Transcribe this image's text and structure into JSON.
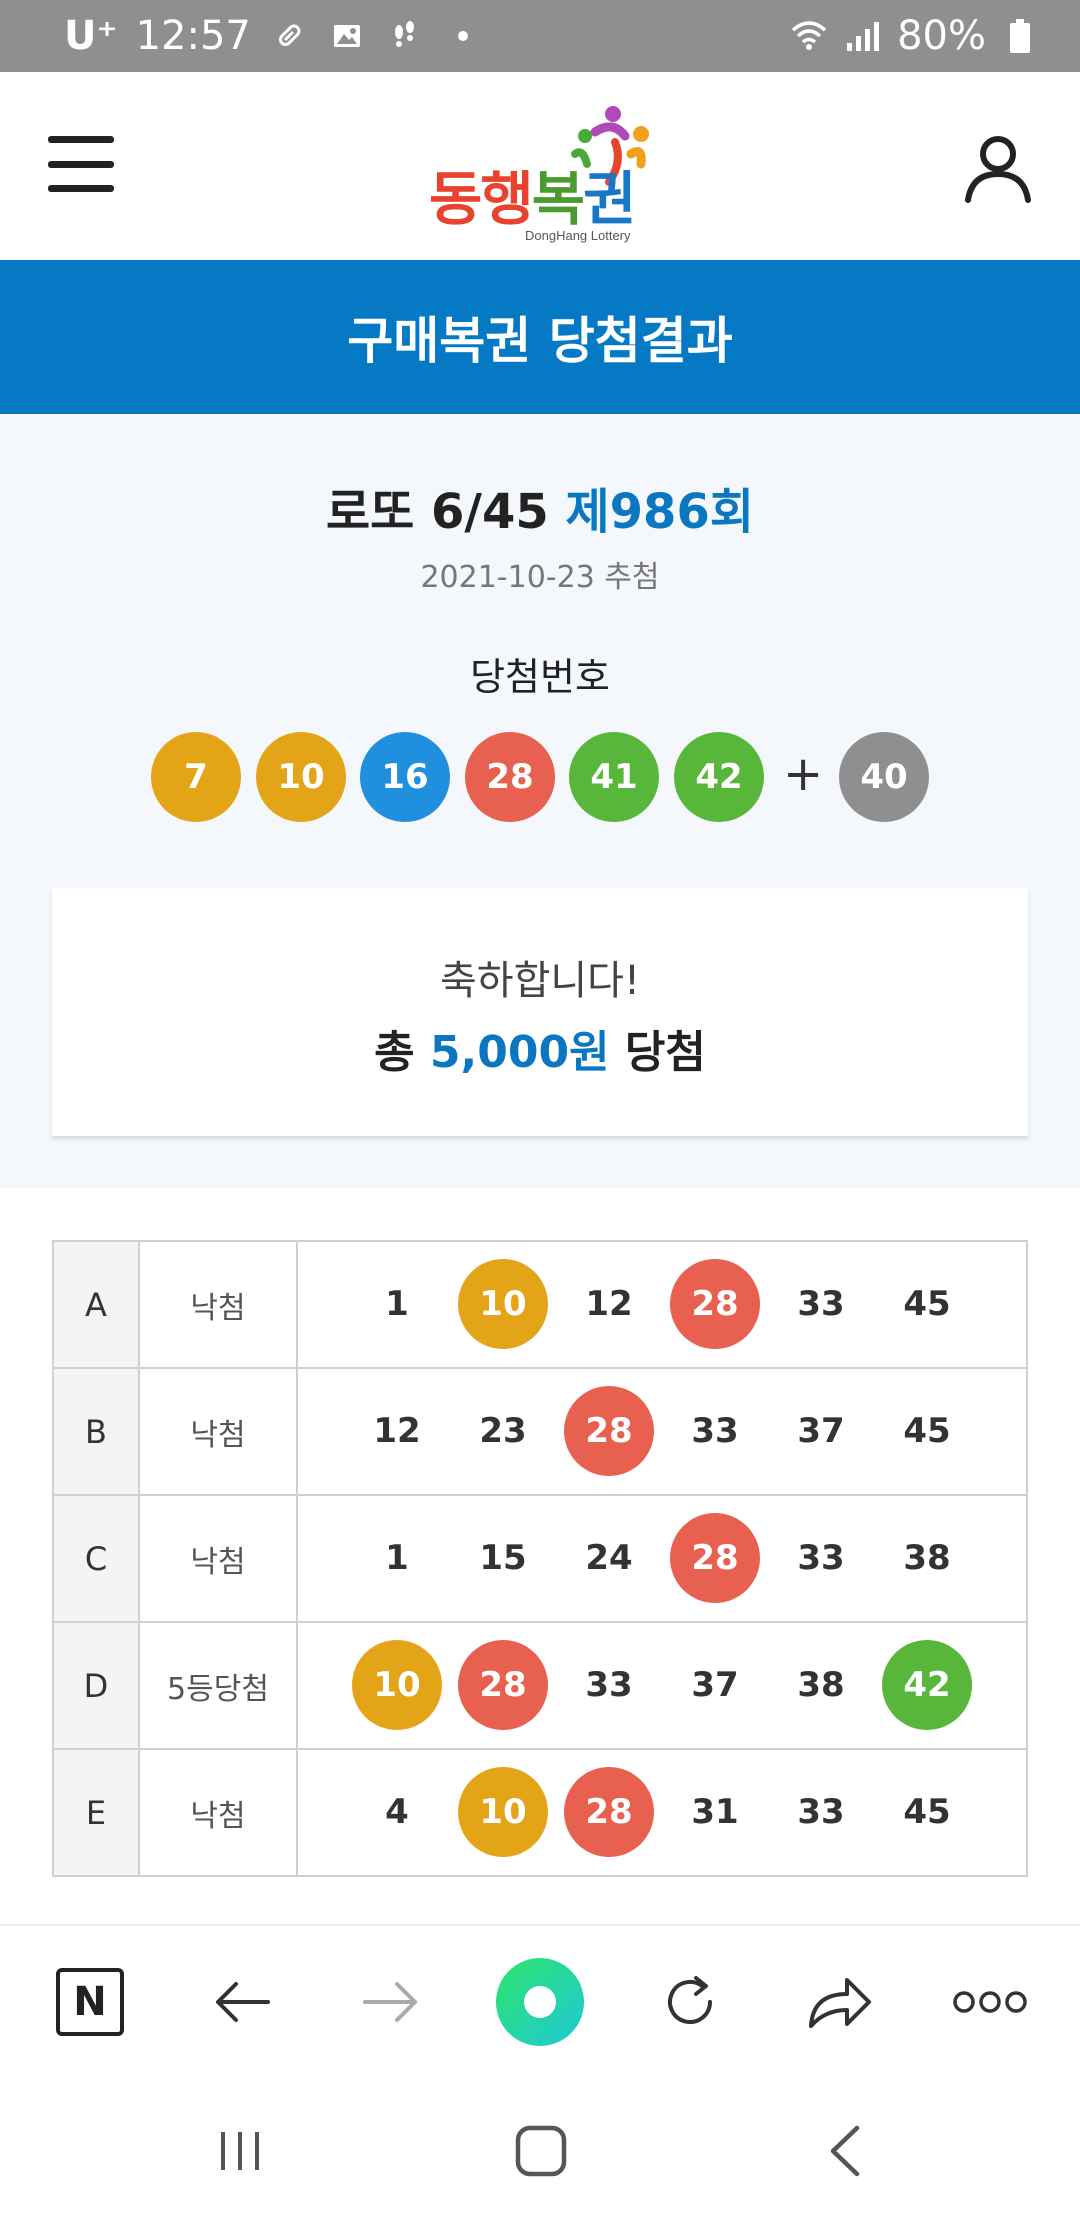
{
  "status_bar": {
    "carrier": "U⁺",
    "time": "12:57",
    "battery": "80%",
    "icons": [
      "pill-icon",
      "image-icon",
      "footsteps-icon",
      "dot-icon",
      "wifi-icon",
      "signal-icon",
      "battery-icon"
    ]
  },
  "header": {
    "logo_text": [
      "동",
      "행",
      "복",
      "권"
    ],
    "logo_colors": [
      "#e8432d",
      "#e8432d",
      "#4a9b2e",
      "#1b76c5"
    ],
    "logo_sub": "DongHang Lottery",
    "menu_icon": "hamburger-menu-icon",
    "user_icon": "user-icon"
  },
  "page_title": "구매복권 당첨결과",
  "draw": {
    "game": "로또 6/45",
    "round": "제986회",
    "date": "2021-10-23 추첨",
    "numbers_label": "당첨번호",
    "numbers": [
      {
        "value": "7",
        "color": "#e4a418"
      },
      {
        "value": "10",
        "color": "#e4a418"
      },
      {
        "value": "16",
        "color": "#2090de"
      },
      {
        "value": "28",
        "color": "#e8604f"
      },
      {
        "value": "41",
        "color": "#58b63a"
      },
      {
        "value": "42",
        "color": "#58b63a"
      }
    ],
    "plus": "+",
    "bonus": {
      "value": "40",
      "color": "#8f8f8f"
    }
  },
  "congrats": {
    "line1": "축하합니다!",
    "prefix": "총",
    "amount": "5,000원",
    "suffix": "당첨"
  },
  "tickets": [
    {
      "id": "A",
      "result": "낙첨",
      "numbers": [
        {
          "value": "1",
          "hit": false
        },
        {
          "value": "10",
          "hit": true,
          "color": "#e4a418"
        },
        {
          "value": "12",
          "hit": false
        },
        {
          "value": "28",
          "hit": true,
          "color": "#e8604f"
        },
        {
          "value": "33",
          "hit": false
        },
        {
          "value": "45",
          "hit": false
        }
      ]
    },
    {
      "id": "B",
      "result": "낙첨",
      "numbers": [
        {
          "value": "12",
          "hit": false
        },
        {
          "value": "23",
          "hit": false
        },
        {
          "value": "28",
          "hit": true,
          "color": "#e8604f"
        },
        {
          "value": "33",
          "hit": false
        },
        {
          "value": "37",
          "hit": false
        },
        {
          "value": "45",
          "hit": false
        }
      ]
    },
    {
      "id": "C",
      "result": "낙첨",
      "numbers": [
        {
          "value": "1",
          "hit": false
        },
        {
          "value": "15",
          "hit": false
        },
        {
          "value": "24",
          "hit": false
        },
        {
          "value": "28",
          "hit": true,
          "color": "#e8604f"
        },
        {
          "value": "33",
          "hit": false
        },
        {
          "value": "38",
          "hit": false
        }
      ]
    },
    {
      "id": "D",
      "result": "5등당첨",
      "numbers": [
        {
          "value": "10",
          "hit": true,
          "color": "#e4a418"
        },
        {
          "value": "28",
          "hit": true,
          "color": "#e8604f"
        },
        {
          "value": "33",
          "hit": false
        },
        {
          "value": "37",
          "hit": false
        },
        {
          "value": "38",
          "hit": false
        },
        {
          "value": "42",
          "hit": true,
          "color": "#58b63a"
        }
      ]
    },
    {
      "id": "E",
      "result": "낙첨",
      "numbers": [
        {
          "value": "4",
          "hit": false
        },
        {
          "value": "10",
          "hit": true,
          "color": "#e4a418"
        },
        {
          "value": "28",
          "hit": true,
          "color": "#e8604f"
        },
        {
          "value": "31",
          "hit": false
        },
        {
          "value": "33",
          "hit": false
        },
        {
          "value": "45",
          "hit": false
        }
      ]
    }
  ],
  "browser_toolbar": {
    "naver_label": "N",
    "buttons": [
      "naver-home-icon",
      "back-arrow-icon",
      "forward-arrow-icon",
      "green-dot-icon",
      "refresh-icon",
      "share-icon",
      "more-icon"
    ],
    "accent": "#1ed1a0"
  },
  "nav_bar": {
    "buttons": [
      "recent-apps-icon",
      "home-icon",
      "back-icon"
    ]
  },
  "colors": {
    "brand_blue": "#0579c4",
    "summary_bg": "#f4f8fc",
    "ball_yellow": "#e4a418",
    "ball_blue": "#2090de",
    "ball_red": "#e8604f",
    "ball_green": "#58b63a",
    "ball_gray": "#8f8f8f"
  }
}
